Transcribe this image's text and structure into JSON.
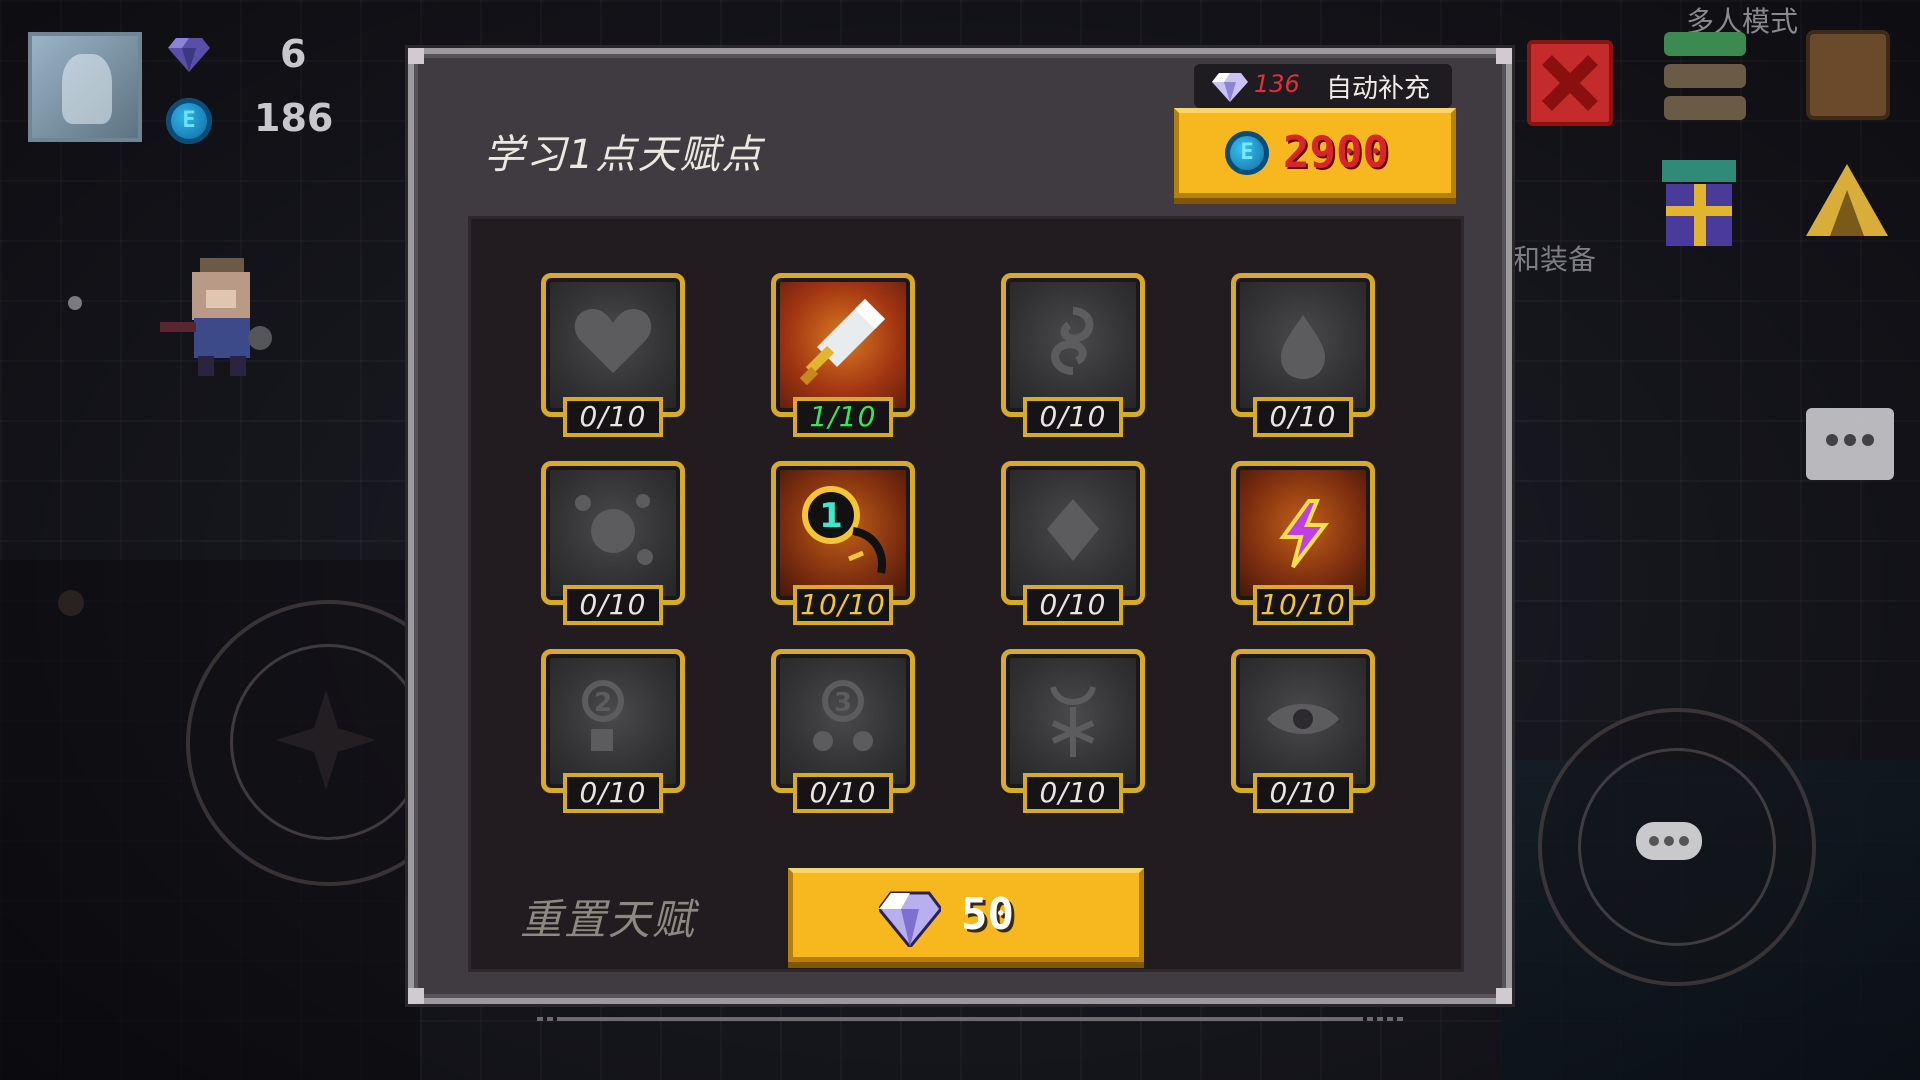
{
  "hud": {
    "gems": "6",
    "coins": "186",
    "coin_glyph": "E",
    "multiplayer_label": "多人模式",
    "equipment_label": "和装备"
  },
  "panel": {
    "title": "学习1点天赋点",
    "auto_refill": {
      "gem_count": "136",
      "label": "自动补充"
    },
    "learn_cost": {
      "coin_glyph": "E",
      "amount": "2900"
    },
    "talents": [
      {
        "icon": "heart-icon",
        "level": "0/10",
        "state": "locked"
      },
      {
        "icon": "sword-icon",
        "level": "1/10",
        "state": "active"
      },
      {
        "icon": "swirl-icon",
        "level": "0/10",
        "state": "locked"
      },
      {
        "icon": "droplet-icon",
        "level": "0/10",
        "state": "locked"
      },
      {
        "icon": "orbs-icon",
        "level": "0/10",
        "state": "locked"
      },
      {
        "icon": "number-one-hook-icon",
        "level": "10/10",
        "state": "maxed"
      },
      {
        "icon": "diamond-shield-icon",
        "level": "0/10",
        "state": "locked"
      },
      {
        "icon": "lightning-icon",
        "level": "10/10",
        "state": "maxed"
      },
      {
        "icon": "number-two-icon",
        "level": "0/10",
        "state": "locked"
      },
      {
        "icon": "number-three-icon",
        "level": "0/10",
        "state": "locked"
      },
      {
        "icon": "snowflake-icon",
        "level": "0/10",
        "state": "locked"
      },
      {
        "icon": "eye-icon",
        "level": "0/10",
        "state": "locked"
      }
    ],
    "reset": {
      "label": "重置天赋",
      "amount": "50"
    }
  },
  "colors": {
    "gold_button": "#f7b81f",
    "frame_gold": "#d7aa2a",
    "active_level_text": "#39e35a",
    "cost_text_red": "#d8252b",
    "gem_count_red": "#e0303a",
    "close_red": "#c62b2b"
  }
}
